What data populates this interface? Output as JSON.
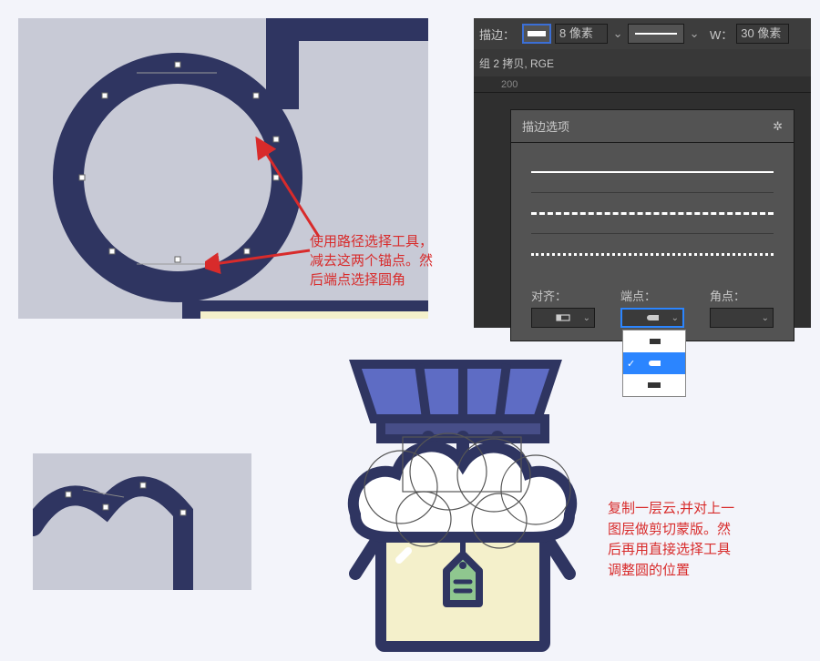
{
  "stroke_panel": {
    "label": "描边：",
    "size_value": "8 像素",
    "width_label": "W：",
    "width_value": "30 像素",
    "sub_label": "组 2 拷贝, RGE",
    "ruler_mark": "200",
    "options_title": "描边选项",
    "align_label": "对齐：",
    "cap_label": "端点：",
    "corner_label": "角点："
  },
  "annotation_1_line1": "使用路径选择工具，",
  "annotation_1_line2": "减去这两个锚点。然",
  "annotation_1_line3": "后端点选择圆角",
  "annotation_2_line1": "复制一层云,并对上一",
  "annotation_2_line2": "图层做剪切蒙版。然",
  "annotation_2_line3": "后再用直接选择工具",
  "annotation_2_line4": "调整圆的位置",
  "colors": {
    "navy": "#2f3561",
    "canvas_bg": "#c8cad6",
    "cream": "#f4f0cb",
    "green": "#8fc78f",
    "purple": "#5e6cc4"
  }
}
